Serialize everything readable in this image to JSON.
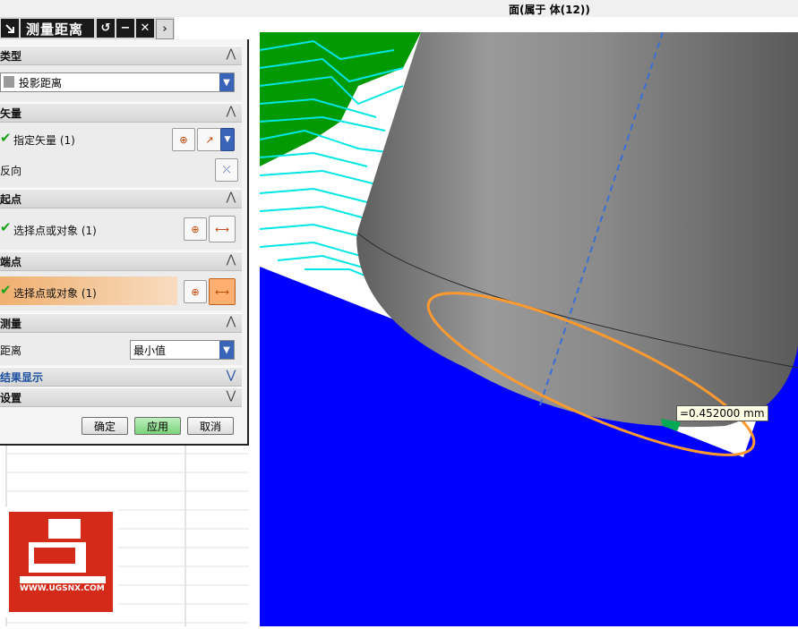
{
  "status_bar": {
    "text": "面(属于 体(12))"
  },
  "dialog": {
    "title": "测量距离",
    "title_buttons": {
      "reset": "↺",
      "minimize": "−",
      "close": "✕",
      "more": "›"
    },
    "sections": {
      "type": {
        "header": "类型",
        "value": "投影距离"
      },
      "vector": {
        "header": "矢量",
        "specify_label": "指定矢量 (1)",
        "reverse_label": "反向"
      },
      "start": {
        "header": "起点",
        "select_label": "选择点或对象 (1)"
      },
      "end": {
        "header": "端点",
        "select_label": "选择点或对象 (1)"
      },
      "measure": {
        "header": "测量",
        "distance_label": "距离",
        "distance_value": "最小值"
      },
      "result": {
        "header": "结果显示"
      },
      "settings": {
        "header": "设置"
      }
    },
    "buttons": {
      "ok": "确定",
      "apply": "应用",
      "cancel": "取消"
    }
  },
  "viewport": {
    "measurement": "=0.452000 mm"
  },
  "logo": {
    "text": "WWW.UGSNX.COM"
  },
  "colors": {
    "background_blue": "#0000ff",
    "cyan_lines": "#00e5e5",
    "green": "#00a000",
    "part_gray": "#808080",
    "highlight_orange": "#ff9a30"
  }
}
